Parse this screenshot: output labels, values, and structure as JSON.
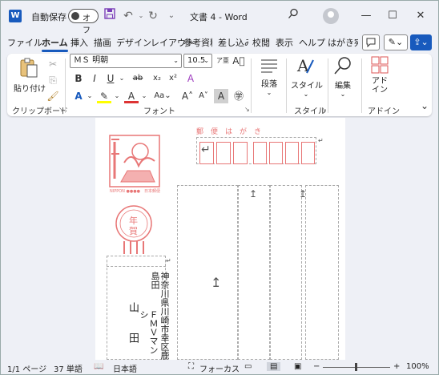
{
  "titlebar": {
    "logo": "W",
    "autosave_label": "自動保存",
    "autosave_state": "オフ",
    "doc_title": "文書 4 - Word",
    "icons": [
      "save-icon",
      "undo-icon",
      "redo-icon",
      "search-icon",
      "account-icon",
      "minimize-icon",
      "maximize-icon",
      "close-icon"
    ]
  },
  "tabs": [
    "ファイル",
    "ホーム",
    "挿入",
    "描画",
    "デザイン",
    "レイアウト",
    "参考資料",
    "差し込み",
    "校閲",
    "表示",
    "ヘルプ",
    "はがき宛"
  ],
  "active_tab": "ホーム",
  "ribbon": {
    "clipboard": {
      "label": "クリップボード",
      "paste": "貼り付け"
    },
    "font": {
      "label": "フォント",
      "name": "ＭＳ 明朝",
      "size": "10.5"
    },
    "paragraph": {
      "label": "段落"
    },
    "style": {
      "label": "スタイル",
      "style_btn": "スタイル"
    },
    "editing": {
      "label": "編集"
    },
    "addin": {
      "label": "アドイン",
      "btn": "アド\nイン"
    }
  },
  "postcard": {
    "header": "郵　便　は　が　き",
    "stamp_label": "NIPPON ●●●●　日本郵便",
    "newyear": "年\n賀",
    "address": "神奈川県川崎市幸区鹿島田",
    "building": "ＦＭＶマンシ",
    "name1": "山",
    "name2": "田"
  },
  "statusbar": {
    "page": "1/1 ページ",
    "words": "37 単語",
    "lang": "日本語",
    "focus": "フォーカス",
    "zoom": "100%"
  },
  "colors": {
    "accent": "#185abd",
    "postal_red": "#e87777"
  }
}
